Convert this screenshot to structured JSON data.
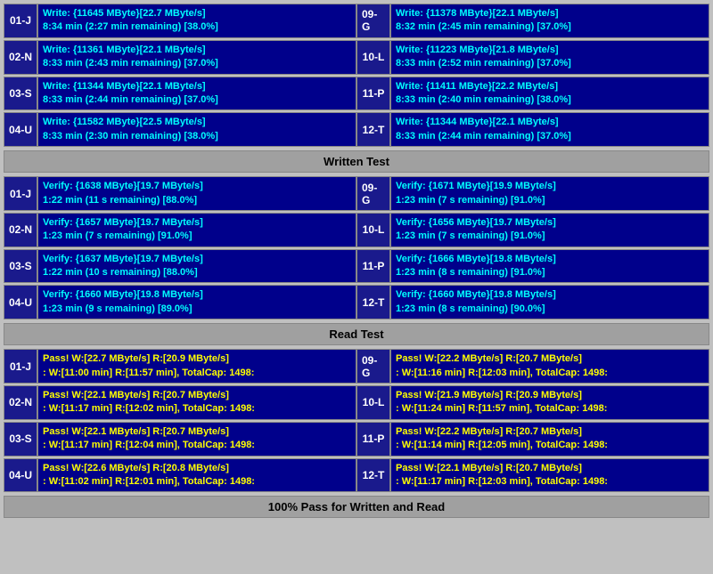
{
  "sections": {
    "write_test": {
      "header": "Written Test",
      "rows": [
        {
          "left_label": "01-J",
          "left_text1": "Write: {11645 MByte}[22.7 MByte/s]",
          "left_text2": "8:34 min (2:27 min remaining)  [38.0%]",
          "right_label": "09-G",
          "right_text1": "Write: {11378 MByte}[22.1 MByte/s]",
          "right_text2": "8:32 min (2:45 min remaining)  [37.0%]"
        },
        {
          "left_label": "02-N",
          "left_text1": "Write: {11361 MByte}[22.1 MByte/s]",
          "left_text2": "8:33 min (2:43 min remaining)  [37.0%]",
          "right_label": "10-L",
          "right_text1": "Write: {11223 MByte}[21.8 MByte/s]",
          "right_text2": "8:33 min (2:52 min remaining)  [37.0%]"
        },
        {
          "left_label": "03-S",
          "left_text1": "Write: {11344 MByte}[22.1 MByte/s]",
          "left_text2": "8:33 min (2:44 min remaining)  [37.0%]",
          "right_label": "11-P",
          "right_text1": "Write: {11411 MByte}[22.2 MByte/s]",
          "right_text2": "8:33 min (2:40 min remaining)  [38.0%]"
        },
        {
          "left_label": "04-U",
          "left_text1": "Write: {11582 MByte}[22.5 MByte/s]",
          "left_text2": "8:33 min (2:30 min remaining)  [38.0%]",
          "right_label": "12-T",
          "right_text1": "Write: {11344 MByte}[22.1 MByte/s]",
          "right_text2": "8:33 min (2:44 min remaining)  [37.0%]"
        }
      ]
    },
    "verify_test": {
      "rows": [
        {
          "left_label": "01-J",
          "left_text1": "Verify: {1638 MByte}[19.7 MByte/s]",
          "left_text2": "1:22 min (11 s remaining)  [88.0%]",
          "right_label": "09-G",
          "right_text1": "Verify: {1671 MByte}[19.9 MByte/s]",
          "right_text2": "1:23 min (7 s remaining)  [91.0%]"
        },
        {
          "left_label": "02-N",
          "left_text1": "Verify: {1657 MByte}[19.7 MByte/s]",
          "left_text2": "1:23 min (7 s remaining)  [91.0%]",
          "right_label": "10-L",
          "right_text1": "Verify: {1656 MByte}[19.7 MByte/s]",
          "right_text2": "1:23 min (7 s remaining)  [91.0%]"
        },
        {
          "left_label": "03-S",
          "left_text1": "Verify: {1637 MByte}[19.7 MByte/s]",
          "left_text2": "1:22 min (10 s remaining)  [88.0%]",
          "right_label": "11-P",
          "right_text1": "Verify: {1666 MByte}[19.8 MByte/s]",
          "right_text2": "1:23 min (8 s remaining)  [91.0%]"
        },
        {
          "left_label": "04-U",
          "left_text1": "Verify: {1660 MByte}[19.8 MByte/s]",
          "left_text2": "1:23 min (9 s remaining)  [89.0%]",
          "right_label": "12-T",
          "right_text1": "Verify: {1660 MByte}[19.8 MByte/s]",
          "right_text2": "1:23 min (8 s remaining)  [90.0%]"
        }
      ]
    },
    "read_test": {
      "header": "Read Test",
      "rows": [
        {
          "left_label": "01-J",
          "left_text1": "Pass! W:[22.7 MByte/s] R:[20.9 MByte/s]",
          "left_text2": ": W:[11:00 min] R:[11:57 min], TotalCap: 1498:",
          "right_label": "09-G",
          "right_text1": "Pass! W:[22.2 MByte/s] R:[20.7 MByte/s]",
          "right_text2": ": W:[11:16 min] R:[12:03 min], TotalCap: 1498:"
        },
        {
          "left_label": "02-N",
          "left_text1": "Pass! W:[22.1 MByte/s] R:[20.7 MByte/s]",
          "left_text2": ": W:[11:17 min] R:[12:02 min], TotalCap: 1498:",
          "right_label": "10-L",
          "right_text1": "Pass! W:[21.9 MByte/s] R:[20.9 MByte/s]",
          "right_text2": ": W:[11:24 min] R:[11:57 min], TotalCap: 1498:"
        },
        {
          "left_label": "03-S",
          "left_text1": "Pass! W:[22.1 MByte/s] R:[20.7 MByte/s]",
          "left_text2": ": W:[11:17 min] R:[12:04 min], TotalCap: 1498:",
          "right_label": "11-P",
          "right_text1": "Pass! W:[22.2 MByte/s] R:[20.7 MByte/s]",
          "right_text2": ": W:[11:14 min] R:[12:05 min], TotalCap: 1498:"
        },
        {
          "left_label": "04-U",
          "left_text1": "Pass! W:[22.6 MByte/s] R:[20.8 MByte/s]",
          "left_text2": ": W:[11:02 min] R:[12:01 min], TotalCap: 1498:",
          "right_label": "12-T",
          "right_text1": "Pass! W:[22.1 MByte/s] R:[20.7 MByte/s]",
          "right_text2": ": W:[11:17 min] R:[12:03 min], TotalCap: 1498:"
        }
      ]
    },
    "written_test_header": "Written Test",
    "read_test_header": "Read Test",
    "footer": "100% Pass for Written and Read"
  }
}
